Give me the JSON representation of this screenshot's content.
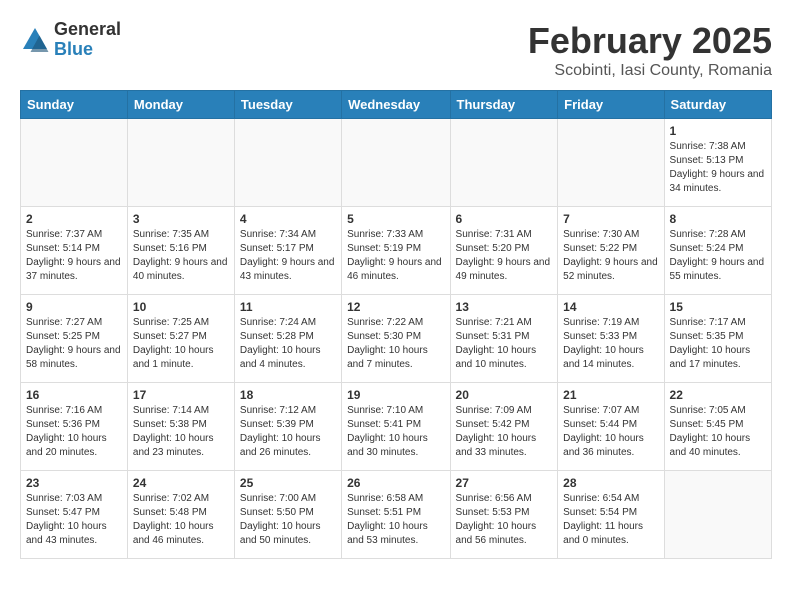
{
  "logo": {
    "general": "General",
    "blue": "Blue"
  },
  "title": "February 2025",
  "subtitle": "Scobinti, Iasi County, Romania",
  "weekdays": [
    "Sunday",
    "Monday",
    "Tuesday",
    "Wednesday",
    "Thursday",
    "Friday",
    "Saturday"
  ],
  "weeks": [
    [
      {
        "day": "",
        "info": ""
      },
      {
        "day": "",
        "info": ""
      },
      {
        "day": "",
        "info": ""
      },
      {
        "day": "",
        "info": ""
      },
      {
        "day": "",
        "info": ""
      },
      {
        "day": "",
        "info": ""
      },
      {
        "day": "1",
        "info": "Sunrise: 7:38 AM\nSunset: 5:13 PM\nDaylight: 9 hours and 34 minutes."
      }
    ],
    [
      {
        "day": "2",
        "info": "Sunrise: 7:37 AM\nSunset: 5:14 PM\nDaylight: 9 hours and 37 minutes."
      },
      {
        "day": "3",
        "info": "Sunrise: 7:35 AM\nSunset: 5:16 PM\nDaylight: 9 hours and 40 minutes."
      },
      {
        "day": "4",
        "info": "Sunrise: 7:34 AM\nSunset: 5:17 PM\nDaylight: 9 hours and 43 minutes."
      },
      {
        "day": "5",
        "info": "Sunrise: 7:33 AM\nSunset: 5:19 PM\nDaylight: 9 hours and 46 minutes."
      },
      {
        "day": "6",
        "info": "Sunrise: 7:31 AM\nSunset: 5:20 PM\nDaylight: 9 hours and 49 minutes."
      },
      {
        "day": "7",
        "info": "Sunrise: 7:30 AM\nSunset: 5:22 PM\nDaylight: 9 hours and 52 minutes."
      },
      {
        "day": "8",
        "info": "Sunrise: 7:28 AM\nSunset: 5:24 PM\nDaylight: 9 hours and 55 minutes."
      }
    ],
    [
      {
        "day": "9",
        "info": "Sunrise: 7:27 AM\nSunset: 5:25 PM\nDaylight: 9 hours and 58 minutes."
      },
      {
        "day": "10",
        "info": "Sunrise: 7:25 AM\nSunset: 5:27 PM\nDaylight: 10 hours and 1 minute."
      },
      {
        "day": "11",
        "info": "Sunrise: 7:24 AM\nSunset: 5:28 PM\nDaylight: 10 hours and 4 minutes."
      },
      {
        "day": "12",
        "info": "Sunrise: 7:22 AM\nSunset: 5:30 PM\nDaylight: 10 hours and 7 minutes."
      },
      {
        "day": "13",
        "info": "Sunrise: 7:21 AM\nSunset: 5:31 PM\nDaylight: 10 hours and 10 minutes."
      },
      {
        "day": "14",
        "info": "Sunrise: 7:19 AM\nSunset: 5:33 PM\nDaylight: 10 hours and 14 minutes."
      },
      {
        "day": "15",
        "info": "Sunrise: 7:17 AM\nSunset: 5:35 PM\nDaylight: 10 hours and 17 minutes."
      }
    ],
    [
      {
        "day": "16",
        "info": "Sunrise: 7:16 AM\nSunset: 5:36 PM\nDaylight: 10 hours and 20 minutes."
      },
      {
        "day": "17",
        "info": "Sunrise: 7:14 AM\nSunset: 5:38 PM\nDaylight: 10 hours and 23 minutes."
      },
      {
        "day": "18",
        "info": "Sunrise: 7:12 AM\nSunset: 5:39 PM\nDaylight: 10 hours and 26 minutes."
      },
      {
        "day": "19",
        "info": "Sunrise: 7:10 AM\nSunset: 5:41 PM\nDaylight: 10 hours and 30 minutes."
      },
      {
        "day": "20",
        "info": "Sunrise: 7:09 AM\nSunset: 5:42 PM\nDaylight: 10 hours and 33 minutes."
      },
      {
        "day": "21",
        "info": "Sunrise: 7:07 AM\nSunset: 5:44 PM\nDaylight: 10 hours and 36 minutes."
      },
      {
        "day": "22",
        "info": "Sunrise: 7:05 AM\nSunset: 5:45 PM\nDaylight: 10 hours and 40 minutes."
      }
    ],
    [
      {
        "day": "23",
        "info": "Sunrise: 7:03 AM\nSunset: 5:47 PM\nDaylight: 10 hours and 43 minutes."
      },
      {
        "day": "24",
        "info": "Sunrise: 7:02 AM\nSunset: 5:48 PM\nDaylight: 10 hours and 46 minutes."
      },
      {
        "day": "25",
        "info": "Sunrise: 7:00 AM\nSunset: 5:50 PM\nDaylight: 10 hours and 50 minutes."
      },
      {
        "day": "26",
        "info": "Sunrise: 6:58 AM\nSunset: 5:51 PM\nDaylight: 10 hours and 53 minutes."
      },
      {
        "day": "27",
        "info": "Sunrise: 6:56 AM\nSunset: 5:53 PM\nDaylight: 10 hours and 56 minutes."
      },
      {
        "day": "28",
        "info": "Sunrise: 6:54 AM\nSunset: 5:54 PM\nDaylight: 11 hours and 0 minutes."
      },
      {
        "day": "",
        "info": ""
      }
    ]
  ]
}
